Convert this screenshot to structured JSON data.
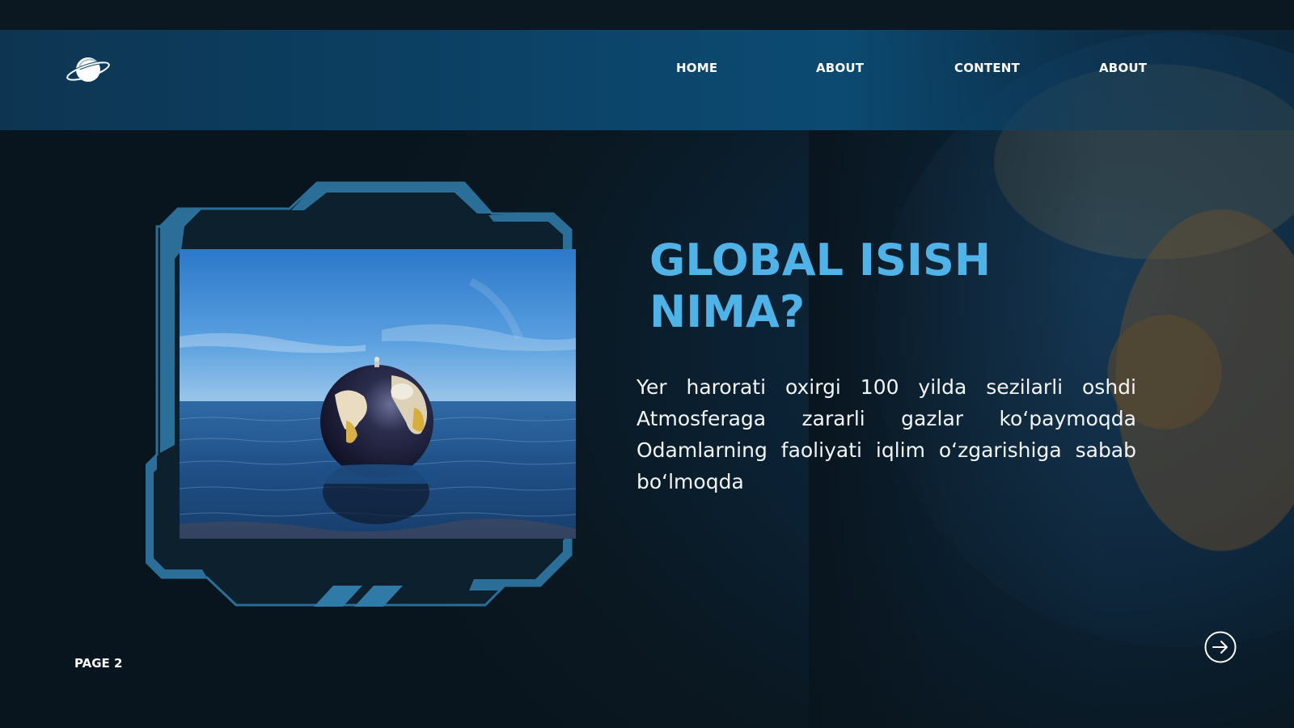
{
  "header": {
    "logo_icon": "planet-ring-icon",
    "nav": [
      {
        "label": "HOME"
      },
      {
        "label": "ABOUT"
      },
      {
        "label": "CONTENT"
      },
      {
        "label": "ABOUT"
      }
    ]
  },
  "main": {
    "title_line1": "GLOBAL ISISH",
    "title_line2": "NIMA?",
    "paragraph": "Yer harorati oxirgi 100 yilda sezilarli oshdi Atmosferaga zararli gazlar koʻpaymoqda Odamlarning faoliyati iqlim oʻzgarishiga sabab boʻlmoqda",
    "image_icon": "globe-in-sea-photo"
  },
  "footer": {
    "page_label": "PAGE 2",
    "next_icon": "arrow-right-circle-icon"
  },
  "colors": {
    "accent": "#4fb3e8",
    "header": "#0c4469",
    "background": "#0b1a24",
    "frame": "#2b6f98"
  }
}
